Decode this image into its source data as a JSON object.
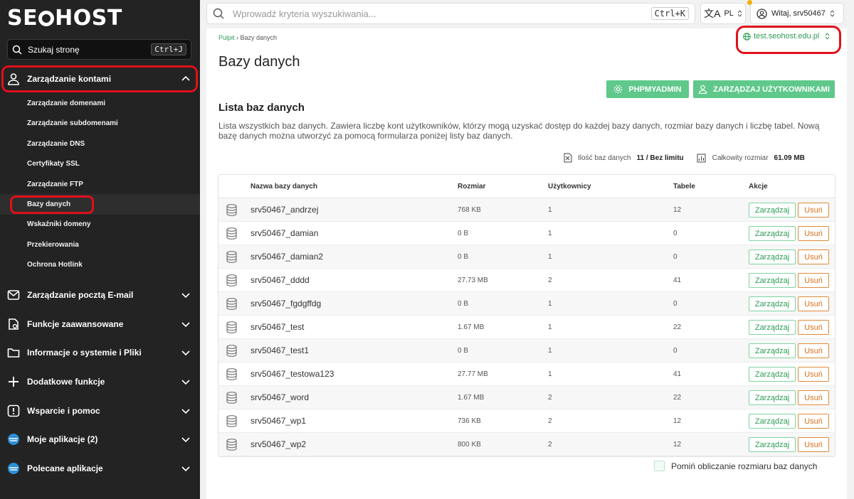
{
  "brand": {
    "logo_left": "SE",
    "logo_right": "HOST"
  },
  "sidebar": {
    "search_label": "Szukaj stronę",
    "search_shortcut": "Ctrl+J",
    "account": "Zarządzanie kontami",
    "sub_items": [
      "Zarządzanie domenami",
      "Zarządzanie subdomenami",
      "Zarządzanie DNS",
      "Certyfikaty SSL",
      "Zarządzanie FTP",
      "Bazy danych",
      "Wskaźniki domeny",
      "Przekierowania",
      "Ochrona Hotlink"
    ],
    "sections": [
      "Zarządzanie pocztą E-mail",
      "Funkcje zaawansowane",
      "Informacje o systemie i Pliki",
      "Dodatkowe funkcje",
      "Wsparcie i pomoc",
      "Moje aplikacje (2)",
      "Polecane aplikacje"
    ]
  },
  "topbar": {
    "search_placeholder": "Wprowadź kryteria wyszukiwania...",
    "search_shortcut": "Ctrl+K",
    "lang": "PL",
    "user": "Witaj, srv50467"
  },
  "breadcrumb": {
    "home": "Pulpit",
    "current": "Bazy danych"
  },
  "domain": "test.seohost.edu.pl",
  "page_title": "Bazy danych",
  "buttons": {
    "phpmyadmin": "PHPMYADMIN",
    "users": "ZARZĄDZAJ UŻYTKOWNIKAMI"
  },
  "list_title": "Lista baz danych",
  "description": "Lista wszystkich baz danych. Zawiera liczbę kont użytkowników, którzy mogą uzyskać dostęp do każdej bazy danych, rozmiar bazy danych i liczbę tabel. Nową bazę danych można utworzyć za pomocą formularza poniżej listy baz danych.",
  "stats": {
    "count_label": "Ilość baz danych",
    "count_value": "11 / Bez limitu",
    "size_label": "Całkowity rozmiar",
    "size_value": "61.09 MB"
  },
  "table": {
    "headers": {
      "name": "Nazwa bazy danych",
      "size": "Rozmiar",
      "users": "Użytkownicy",
      "tables": "Tabele",
      "actions": "Akcje"
    },
    "manage_label": "Zarządzaj",
    "delete_label": "Usuń",
    "rows": [
      {
        "name": "srv50467_andrzej",
        "size": "768 KB",
        "users": "1",
        "tables": "12"
      },
      {
        "name": "srv50467_damian",
        "size": "0 B",
        "users": "1",
        "tables": "0"
      },
      {
        "name": "srv50467_damian2",
        "size": "0 B",
        "users": "1",
        "tables": "0"
      },
      {
        "name": "srv50467_dddd",
        "size": "27.73 MB",
        "users": "2",
        "tables": "41"
      },
      {
        "name": "srv50467_fgdgffdg",
        "size": "0 B",
        "users": "1",
        "tables": "0"
      },
      {
        "name": "srv50467_test",
        "size": "1.67 MB",
        "users": "1",
        "tables": "22"
      },
      {
        "name": "srv50467_test1",
        "size": "0 B",
        "users": "1",
        "tables": "0"
      },
      {
        "name": "srv50467_testowa123",
        "size": "27.77 MB",
        "users": "1",
        "tables": "41"
      },
      {
        "name": "srv50467_word",
        "size": "1.67 MB",
        "users": "2",
        "tables": "22"
      },
      {
        "name": "srv50467_wp1",
        "size": "736 KB",
        "users": "2",
        "tables": "12"
      },
      {
        "name": "srv50467_wp2",
        "size": "800 KB",
        "users": "2",
        "tables": "12"
      }
    ]
  },
  "skip_size_label": "Pomiń obliczanie rozmiaru baz danych",
  "colors": {
    "green": "#5fc88a",
    "accent_text": "#2d9c55",
    "delete": "#d7701b",
    "highlight": "#e0101a",
    "sidebar_bg": "#232323"
  }
}
